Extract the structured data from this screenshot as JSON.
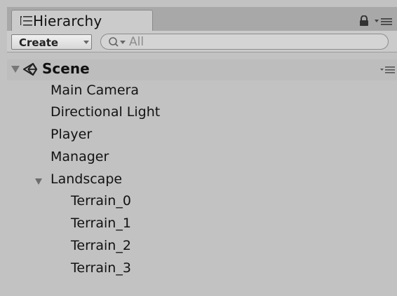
{
  "window": {
    "tab_title": "Hierarchy",
    "icons": [
      "hierarchy-list-icon",
      "lock-icon",
      "tab-menu-icon"
    ]
  },
  "toolbar": {
    "create_label": "Create",
    "search_placeholder": "All"
  },
  "scene": {
    "name": "Scene",
    "expanded": true
  },
  "hierarchy": {
    "items": [
      {
        "label": "Main Camera"
      },
      {
        "label": "Directional Light"
      },
      {
        "label": "Player"
      },
      {
        "label": "Manager"
      },
      {
        "label": "Landscape",
        "expanded": true
      },
      {
        "label": "Terrain_0"
      },
      {
        "label": "Terrain_1"
      },
      {
        "label": "Terrain_2"
      },
      {
        "label": "Terrain_3"
      }
    ]
  },
  "colors": {
    "panel_bg": "#c2c2c2",
    "toolbar_bg": "#cbcbcb",
    "text": "#121212"
  }
}
